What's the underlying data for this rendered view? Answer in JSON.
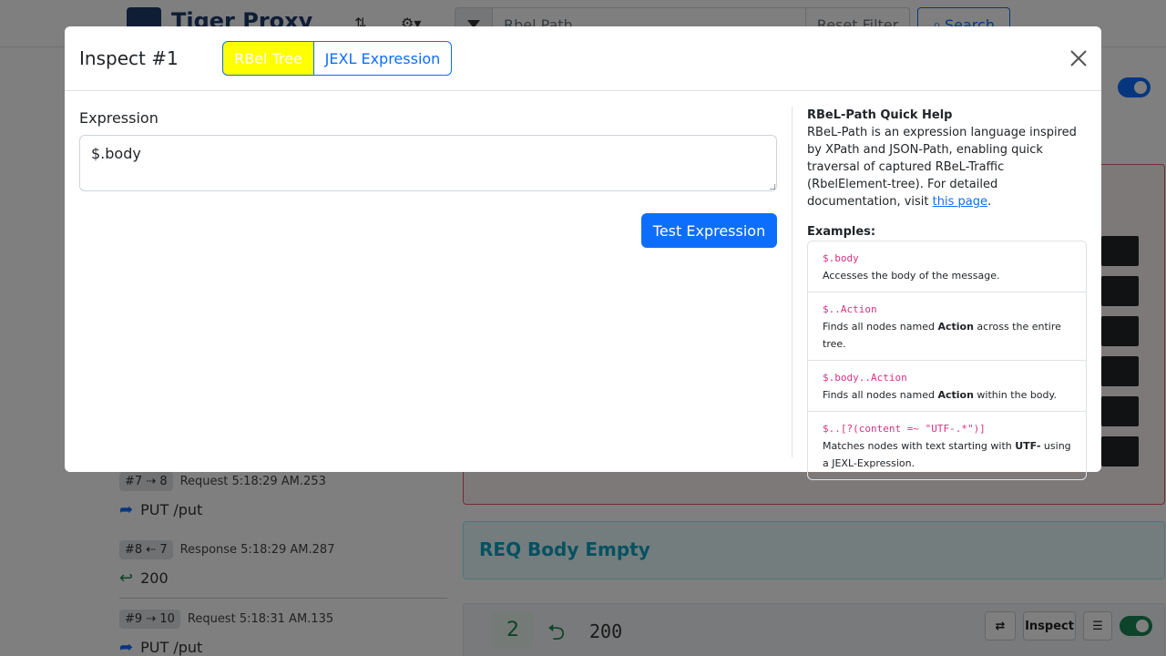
{
  "app": {
    "title": "Tiger Proxy",
    "filter_placeholder": "Rbel Path",
    "reset_filter_label": "Reset Filter",
    "search_label": "Search"
  },
  "sidebar": {
    "messages": [
      {
        "tag": "#7 ⇢ 8",
        "meta": "Request 5:18:29 AM.253",
        "line": "PUT /put",
        "kind": "request"
      },
      {
        "tag": "#8 ⇠ 7",
        "meta": "Response 5:18:29 AM.287",
        "line": "200",
        "kind": "response"
      },
      {
        "tag": "#9 ⇢ 10",
        "meta": "Request 5:18:31 AM.135",
        "line": "PUT /put",
        "kind": "request"
      }
    ]
  },
  "main": {
    "body_card_title": "REQ Body Empty",
    "footer": {
      "sequence": "2",
      "status": "200",
      "inspect_label": "Inspect"
    }
  },
  "modal": {
    "title": "Inspect #1",
    "tabs": [
      {
        "label": "RBel Tree",
        "active": true
      },
      {
        "label": "JEXL Expression",
        "active": false
      }
    ],
    "expression_label": "Expression",
    "expression_value": "$.body",
    "test_button_label": "Test Expression",
    "help": {
      "title": "RBeL-Path Quick Help",
      "desc_before_link": "RBeL-Path is an expression language inspired by XPath and JSON-Path, enabling quick traversal of captured RBeL-Traffic (RbelElement-tree). For detailed documentation, visit ",
      "link_text": "this page",
      "desc_after_link": ".",
      "examples_title": "Examples:",
      "examples": [
        {
          "code": "$.body",
          "pre": "Accesses the body of the message.",
          "bold": "",
          "post": ""
        },
        {
          "code": "$..Action",
          "pre": "Finds all nodes named ",
          "bold": "Action",
          "post": " across the entire tree."
        },
        {
          "code": "$.body..Action",
          "pre": "Finds all nodes named ",
          "bold": "Action",
          "post": " within the body."
        },
        {
          "code": "$..[?(content =~ \"UTF-.*\")]",
          "pre": "Matches nodes with text starting with ",
          "bold": "UTF-",
          "post": " using a JEXL-Expression."
        }
      ]
    }
  },
  "colors": {
    "primary": "#0d6efd",
    "active_tab": "#ffff00",
    "success": "#198754",
    "code": "#d63384"
  }
}
